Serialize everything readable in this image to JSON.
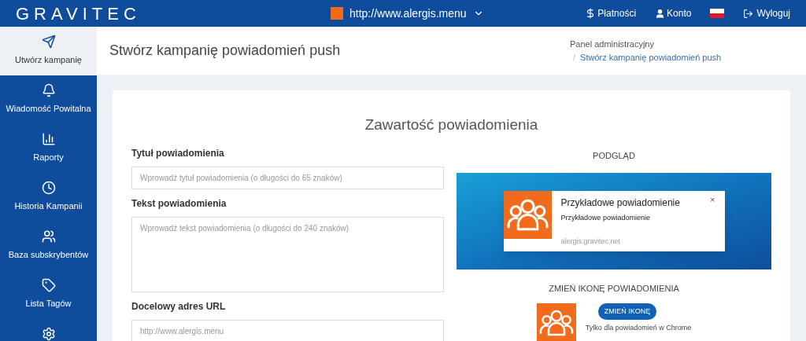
{
  "header": {
    "logo": "GRAVITEC",
    "site": "http://www.alergis.menu",
    "links": [
      {
        "kind": "payments",
        "label": "Płatności"
      },
      {
        "kind": "account",
        "label": "Konto"
      },
      {
        "kind": "flag"
      },
      {
        "kind": "logout",
        "label": "Wyloguj"
      }
    ]
  },
  "sidebar": {
    "items": [
      {
        "kind": "send",
        "label": "Utwórz kampanię",
        "selected": true
      },
      {
        "kind": "bell",
        "label": "Wiadomość Powitalna",
        "selected": false
      },
      {
        "kind": "chart",
        "label": "Raporty",
        "selected": false
      },
      {
        "kind": "clock",
        "label": "Historia Kampanii",
        "selected": false
      },
      {
        "kind": "users",
        "label": "Baza subskrybentów",
        "selected": false
      },
      {
        "kind": "tag",
        "label": "Lista Tagów",
        "selected": false
      },
      {
        "kind": "gear",
        "selected": false
      }
    ]
  },
  "page": {
    "title": "Stwórz kampanię powiadomień push",
    "breadcrumb": [
      "Panel administracyjny",
      "/",
      "Stwórz kampanię powiadomień push"
    ]
  },
  "card": {
    "heading": "Zawartość powiadomienia",
    "fields": [
      {
        "kind": "input",
        "label": "Tytuł powiadomienia",
        "placeholder": "Wprowadź tytuł powiadomienia (o długości do 65 znaków)"
      },
      {
        "kind": "textarea",
        "label": "Tekst powiadomienia",
        "placeholder": "Wprowadź tekst powiadomienia (o długości do 240 znaków)"
      },
      {
        "kind": "input",
        "label": "Docelowy adres URL",
        "placeholder": "http://www.alergis.menu"
      }
    ],
    "preview": {
      "heading": "PODGLĄD",
      "title": "Przykładowe powiadomienie",
      "body": "Przykładowe powiadomienie",
      "close": "×",
      "domain": "alergis.gravitec.net"
    },
    "icon_section": {
      "heading": "ZMIEŃ IKONĘ POWIADOMIENIA",
      "button": "ZMIEŃ IKONĘ",
      "note": "Tylko dla powiadomień w Chrome"
    }
  }
}
